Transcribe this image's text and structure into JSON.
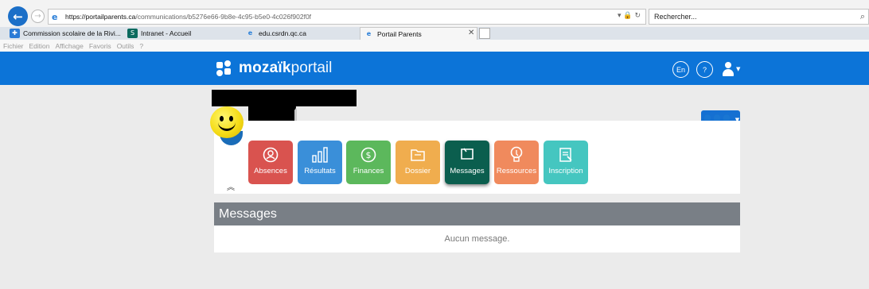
{
  "browser": {
    "url_host": "https://portailparents.ca",
    "url_path": "/communications/b5276e66-9b8e-4c95-b5e0-4c026f902f0f",
    "search_placeholder": "Rechercher...",
    "tabs": [
      {
        "label": "Commission scolaire de la Rivi...",
        "icon": "app-tile-icon",
        "color": "#2b7bd6"
      },
      {
        "label": "Intranet - Accueil",
        "icon": "sharepoint-icon",
        "color": "#0b6a5f"
      },
      {
        "label": "edu.csrdn.qc.ca",
        "icon": "ie-icon",
        "color": "#2a7fd8"
      },
      {
        "label": "Portail Parents",
        "icon": "ie-icon",
        "color": "#2a7fd8"
      }
    ],
    "menu": [
      "Fichier",
      "Edition",
      "Affichage",
      "Favoris",
      "Outils",
      "?"
    ]
  },
  "header": {
    "brand_bold": "mozaïk",
    "brand_thin": "portail",
    "lang_button": "En",
    "help_button": "?",
    "accent_color": "#0c74d8"
  },
  "tiles": [
    {
      "label": "Absences",
      "icon": "person-icon",
      "color": "#d9534f"
    },
    {
      "label": "Résultats",
      "icon": "bar-chart-icon",
      "color": "#3a8fd9"
    },
    {
      "label": "Finances",
      "icon": "dollar-icon",
      "color": "#5cb85c"
    },
    {
      "label": "Dossier",
      "icon": "folder-icon",
      "color": "#f0ad4e"
    },
    {
      "label": "Messages",
      "icon": "message-icon",
      "color": "#0b5e4e"
    },
    {
      "label": "Ressources",
      "icon": "lightbulb-icon",
      "color": "#f08a5d"
    },
    {
      "label": "Inscription",
      "icon": "form-icon",
      "color": "#45c6c0"
    }
  ],
  "messages": {
    "title": "Messages",
    "empty_text": "Aucun message."
  }
}
